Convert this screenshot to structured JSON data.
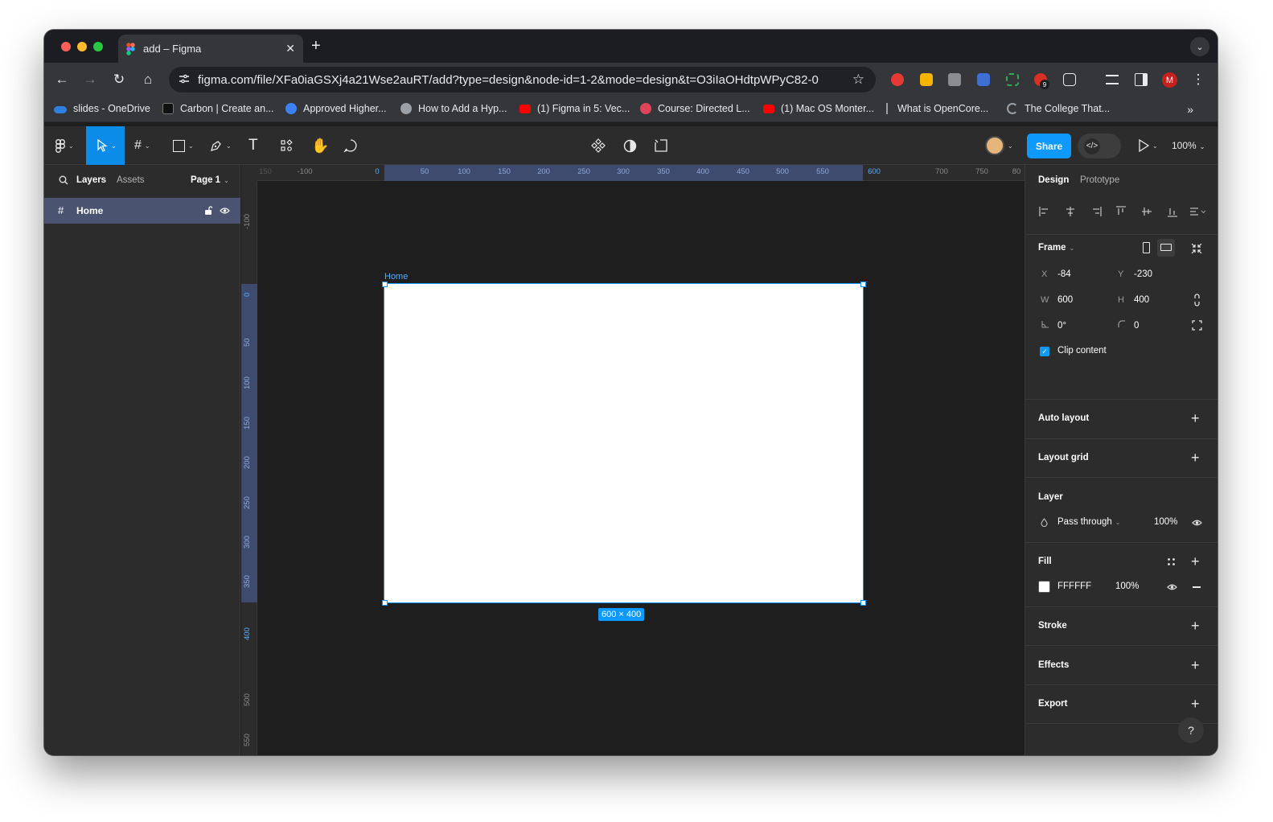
{
  "browser": {
    "tab_title": "add – Figma",
    "tab_close": "✕",
    "new_tab": "+",
    "url": "figma.com/file/XFa0iaGSXj4a21Wse2auRT/add?type=design&node-id=1-2&mode=design&t=O3iIaOHdtpWPyC82-0",
    "extension_badge": "9",
    "profile_initial": "M",
    "bookmarks": [
      {
        "label": "slides - OneDrive",
        "icon": "onedrive-icon",
        "color": "#2f7fe0"
      },
      {
        "label": "Carbon | Create an...",
        "icon": "carbon-icon",
        "color": "#222222"
      },
      {
        "label": "Approved Higher...",
        "icon": "star-badge-icon",
        "color": "#3b82f6"
      },
      {
        "label": "How to Add a Hyp...",
        "icon": "globe-icon",
        "color": "#9aa0a6"
      },
      {
        "label": "(1) Figma in 5: Vec...",
        "icon": "youtube-icon",
        "color": "#ff0000"
      },
      {
        "label": "Course: Directed L...",
        "icon": "course-icon",
        "color": "#e0445a"
      },
      {
        "label": "(1) Mac OS Monter...",
        "icon": "youtube-icon",
        "color": "#ff0000"
      },
      {
        "label": "What is OpenCore...",
        "icon": "opencore-icon",
        "color": "#9aa0a6"
      },
      {
        "label": "The College That...",
        "icon": "college-icon",
        "color": "#9aa0a6"
      }
    ],
    "bookmarks_more": "»"
  },
  "figma_toolbar": {
    "share_label": "Share",
    "zoom_label": "100%",
    "devmode_icon": "</>"
  },
  "left_panel": {
    "tabs": [
      "Layers",
      "Assets"
    ],
    "page_label": "Page 1",
    "layers": [
      {
        "name": "Home",
        "icon": "frame-hash-icon"
      }
    ]
  },
  "canvas": {
    "frame_name": "Home",
    "size_label": "600 × 400",
    "ruler_top": [
      "150",
      "-100",
      "0",
      "50",
      "100",
      "150",
      "200",
      "250",
      "300",
      "350",
      "400",
      "450",
      "500",
      "550",
      "600",
      "700",
      "750",
      "80"
    ],
    "ruler_left": [
      "-100",
      "0",
      "50",
      "100",
      "150",
      "200",
      "250",
      "300",
      "350",
      "400",
      "500",
      "550"
    ]
  },
  "right_panel": {
    "tabs": [
      "Design",
      "Prototype"
    ],
    "frame_label": "Frame",
    "x_label": "X",
    "x_value": "-84",
    "y_label": "Y",
    "y_value": "-230",
    "w_label": "W",
    "w_value": "600",
    "h_label": "H",
    "h_value": "400",
    "rotation_value": "0°",
    "radius_value": "0",
    "clip_content_label": "Clip content",
    "auto_layout_label": "Auto layout",
    "layout_grid_label": "Layout grid",
    "layer_label": "Layer",
    "blend_mode": "Pass through",
    "layer_opacity": "100%",
    "fill_label": "Fill",
    "fill_hex": "FFFFFF",
    "fill_opacity": "100%",
    "fill_color": "#ffffff",
    "stroke_label": "Stroke",
    "effects_label": "Effects",
    "export_label": "Export",
    "help_label": "?"
  },
  "colors": {
    "accent": "#0d99ff",
    "selection_row": "#4a5470",
    "canvas_bg": "#1e1e1e",
    "panel_bg": "#2c2c2c"
  }
}
